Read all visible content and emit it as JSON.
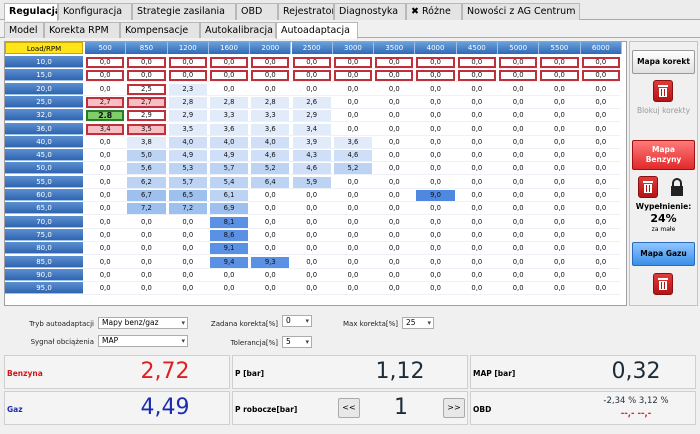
{
  "tabs_main": [
    "Regulacja",
    "Konfiguracja",
    "Strategie zasilania",
    "OBD",
    "Rejestrator",
    "Diagnostyka",
    "Różne",
    "Nowości z AG Centrum"
  ],
  "tabs_sub": [
    "Model",
    "Korekta RPM",
    "Kompensacje",
    "Autokalibracja",
    "Autoadaptacja"
  ],
  "grid": {
    "corner": "Load/RPM",
    "rpm": [
      "500",
      "850",
      "1200",
      "1600",
      "2000",
      "2500",
      "3000",
      "3500",
      "4000",
      "4500",
      "5000",
      "5500",
      "6000"
    ],
    "load": [
      "10,0",
      "15,0",
      "20,0",
      "25,0",
      "32,0",
      "36,0",
      "40,0",
      "45,0",
      "50,0",
      "55,0",
      "60,0",
      "65,0",
      "70,0",
      "75,0",
      "80,0",
      "85,0",
      "90,0",
      "95,0"
    ],
    "rows": [
      [
        "0,0",
        "0,0",
        "0,0",
        "0,0",
        "0,0",
        "0,0",
        "0,0",
        "0,0",
        "0,0",
        "0,0",
        "0,0",
        "0,0",
        "0,0"
      ],
      [
        "0,0",
        "0,0",
        "0,0",
        "0,0",
        "0,0",
        "0,0",
        "0,0",
        "0,0",
        "0,0",
        "0,0",
        "0,0",
        "0,0",
        "0,0"
      ],
      [
        "0,0",
        "2,5",
        "2,3",
        "0,0",
        "0,0",
        "0,0",
        "0,0",
        "0,0",
        "0,0",
        "0,0",
        "0,0",
        "0,0",
        "0,0"
      ],
      [
        "2,7",
        "2,7",
        "2,8",
        "2,8",
        "2,8",
        "2,6",
        "0,0",
        "0,0",
        "0,0",
        "0,0",
        "0,0",
        "0,0",
        "0,0"
      ],
      [
        "2.8",
        "2,9",
        "2,9",
        "3,3",
        "3,3",
        "2,9",
        "0,0",
        "0,0",
        "0,0",
        "0,0",
        "0,0",
        "0,0",
        "0,0"
      ],
      [
        "3,4",
        "3,5",
        "3,5",
        "3,6",
        "3,6",
        "3,4",
        "0,0",
        "0,0",
        "0,0",
        "0,0",
        "0,0",
        "0,0",
        "0,0"
      ],
      [
        "0,0",
        "3,8",
        "4,0",
        "4,0",
        "4,0",
        "3,9",
        "3,6",
        "0,0",
        "0,0",
        "0,0",
        "0,0",
        "0,0",
        "0,0"
      ],
      [
        "0,0",
        "5,0",
        "4,9",
        "4,9",
        "4,6",
        "4,3",
        "4,6",
        "0,0",
        "0,0",
        "0,0",
        "0,0",
        "0,0",
        "0,0"
      ],
      [
        "0,0",
        "5,6",
        "5,3",
        "5,7",
        "5,2",
        "4,6",
        "5,2",
        "0,0",
        "0,0",
        "0,0",
        "0,0",
        "0,0",
        "0,0"
      ],
      [
        "0,0",
        "6,2",
        "5,7",
        "5,4",
        "6,4",
        "5,9",
        "0,0",
        "0,0",
        "0,0",
        "0,0",
        "0,0",
        "0,0",
        "0,0"
      ],
      [
        "0,0",
        "6,7",
        "6,5",
        "6,1",
        "0,0",
        "0,0",
        "0,0",
        "0,0",
        "9,0",
        "0,0",
        "0,0",
        "0,0",
        "0,0"
      ],
      [
        "0,0",
        "7,2",
        "7,2",
        "6,9",
        "0,0",
        "0,0",
        "0,0",
        "0,0",
        "0,0",
        "0,0",
        "0,0",
        "0,0",
        "0,0"
      ],
      [
        "0,0",
        "0,0",
        "0,0",
        "8,1",
        "0,0",
        "0,0",
        "0,0",
        "0,0",
        "0,0",
        "0,0",
        "0,0",
        "0,0",
        "0,0"
      ],
      [
        "0,0",
        "0,0",
        "0,0",
        "8,6",
        "0,0",
        "0,0",
        "0,0",
        "0,0",
        "0,0",
        "0,0",
        "0,0",
        "0,0",
        "0,0"
      ],
      [
        "0,0",
        "0,0",
        "0,0",
        "9,1",
        "0,0",
        "0,0",
        "0,0",
        "0,0",
        "0,0",
        "0,0",
        "0,0",
        "0,0",
        "0,0"
      ],
      [
        "0,0",
        "0,0",
        "0,0",
        "9,4",
        "9,3",
        "0,0",
        "0,0",
        "0,0",
        "0,0",
        "0,0",
        "0,0",
        "0,0",
        "0,0"
      ],
      [
        "0,0",
        "0,0",
        "0,0",
        "0,0",
        "0,0",
        "0,0",
        "0,0",
        "0,0",
        "0,0",
        "0,0",
        "0,0",
        "0,0",
        "0,0"
      ],
      [
        "0,0",
        "0,0",
        "0,0",
        "0,0",
        "0,0",
        "0,0",
        "0,0",
        "0,0",
        "0,0",
        "0,0",
        "0,0",
        "0,0",
        "0,0"
      ]
    ]
  },
  "side": {
    "mapa_korekt": "Mapa korekt",
    "blokuj": "Blokuj korekty",
    "mapa_benzyny": "Mapa Benzyny",
    "wypelnienie_label": "Wypełnienie:",
    "wypelnienie_value": "24%",
    "za_male": "za małe",
    "mapa_gazu": "Mapa Gazu"
  },
  "config": {
    "tryb_label": "Tryb autoadaptacji",
    "tryb_value": "Mapy benz/gaz",
    "sygnal_label": "Sygnał obciążenia",
    "sygnal_value": "MAP",
    "zadana_label": "Zadana korekta[%]",
    "zadana_value": "0",
    "tolerancja_label": "Tolerancja[%]",
    "tolerancja_value": "5",
    "max_label": "Max korekta[%]",
    "max_value": "25"
  },
  "info": {
    "benzyna_label": "Benzyna",
    "benzyna_value": "2,72",
    "gaz_label": "Gaz",
    "gaz_value": "4,49",
    "p_label": "P [bar]",
    "p_value": "1,12",
    "prob_label": "P robocze[bar]",
    "prob_value": "1",
    "prev": "<<",
    "next": ">>",
    "map_label": "MAP [bar]",
    "map_value": "0,32",
    "obd_label": "OBD",
    "obd_value": "-2,34 % 3,12 %",
    "obd_sub": "--,- --,-"
  },
  "colors": {
    "benzyna": "#e02020",
    "gaz": "#1a2db0",
    "accent": "#2f69b8"
  }
}
